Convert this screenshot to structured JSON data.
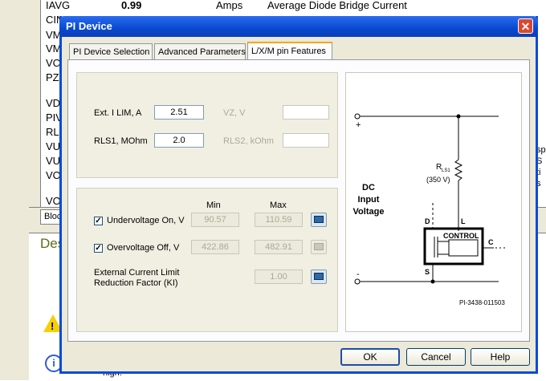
{
  "background": {
    "rows": [
      {
        "name": "IAVG",
        "value": "0.99",
        "unit": "Amps",
        "desc": "Average Diode Bridge Current"
      },
      {
        "name": "CIN"
      },
      {
        "name": "VM"
      },
      {
        "name": "VM"
      },
      {
        "name": "VC"
      },
      {
        "name": "PZ"
      },
      {
        "name": "VD"
      },
      {
        "name": "PIV"
      },
      {
        "name": "RLS"
      },
      {
        "name": "VU"
      },
      {
        "name": "VU"
      },
      {
        "name": "VO"
      },
      {
        "name": "VO"
      }
    ],
    "tab_label": "Block",
    "desc_heading": "Des",
    "hint_text": "high.",
    "right_chars": [
      "sp",
      "S",
      "ti",
      "s"
    ]
  },
  "dialog": {
    "title": "PI Device",
    "close_glyph": "✕",
    "tabs": [
      "PI Device Selection",
      "Advanced Parameters",
      "L/X/M pin Features"
    ],
    "fields": {
      "ext_ilim_label": "Ext. I LIM, A",
      "ext_ilim_value": "2.51",
      "vz_label": "VZ, V",
      "vz_value": "",
      "rls1_label": "RLS1, MOhm",
      "rls1_value": "2.0",
      "rls2_label": "RLS2, kOhm",
      "rls2_value": ""
    },
    "voltage": {
      "min_header": "Min",
      "max_header": "Max",
      "uv_label": "Undervoltage On, V",
      "uv_checked": true,
      "uv_min": "90.57",
      "uv_max": "110.59",
      "ov_label": "Overvoltage Off, V",
      "ov_checked": true,
      "ov_min": "422.86",
      "ov_max": "482.91",
      "kl_label_1": "External Current Limit",
      "kl_label_2": "Reduction Factor (KI)",
      "kl_value": "1.00",
      "check_glyph": "✓"
    },
    "diagram": {
      "plus": "+",
      "minus": "-",
      "dc_1": "DC",
      "dc_2": "Input",
      "dc_3": "Voltage",
      "rls_label": "R",
      "rls_sub": "LS1",
      "rls_value": "(350 V)",
      "pin_d": "D",
      "pin_l": "L",
      "pin_c": "C",
      "pin_s": "S",
      "control": "CONTROL",
      "part_no": "PI-3438-011503"
    },
    "buttons": {
      "ok": "OK",
      "cancel": "Cancel",
      "help": "Help"
    },
    "colors": {
      "title_bar": "#0849d0",
      "close": "#d9482e",
      "tab_accent": "#f4a81c"
    }
  }
}
